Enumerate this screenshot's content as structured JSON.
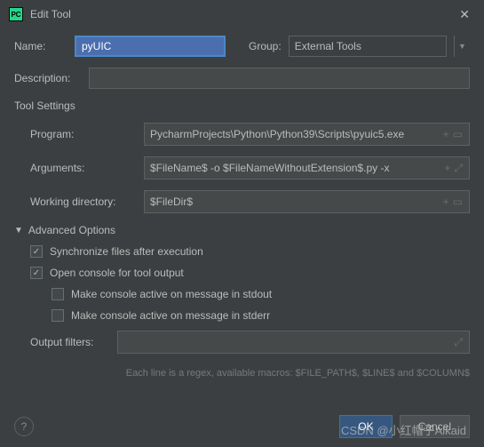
{
  "window": {
    "title": "Edit Tool",
    "app_icon_text": "PC"
  },
  "form": {
    "name_label": "Name:",
    "name_value": "pyUIC",
    "group_label": "Group:",
    "group_value": "External Tools",
    "description_label": "Description:",
    "description_value": ""
  },
  "tool_settings": {
    "section_title": "Tool Settings",
    "program_label": "Program:",
    "program_value": "PycharmProjects\\Python\\Python39\\Scripts\\pyuic5.exe",
    "arguments_label": "Arguments:",
    "arguments_value": "$FileName$ -o $FileNameWithoutExtension$.py -x",
    "working_dir_label": "Working directory:",
    "working_dir_value": "$FileDir$"
  },
  "advanced": {
    "section_title": "Advanced Options",
    "sync_label": "Synchronize files after execution",
    "sync_checked": true,
    "open_console_label": "Open console for tool output",
    "open_console_checked": true,
    "stdout_label": "Make console active on message in stdout",
    "stdout_checked": false,
    "stderr_label": "Make console active on message in stderr",
    "stderr_checked": false,
    "output_filters_label": "Output filters:",
    "output_filters_value": "",
    "hint": "Each line is a regex, available macros: $FILE_PATH$, $LINE$ and $COLUMN$"
  },
  "footer": {
    "ok_label": "OK",
    "cancel_label": "Cancel"
  },
  "watermark": "CSDN @小红帽子Alkaid"
}
